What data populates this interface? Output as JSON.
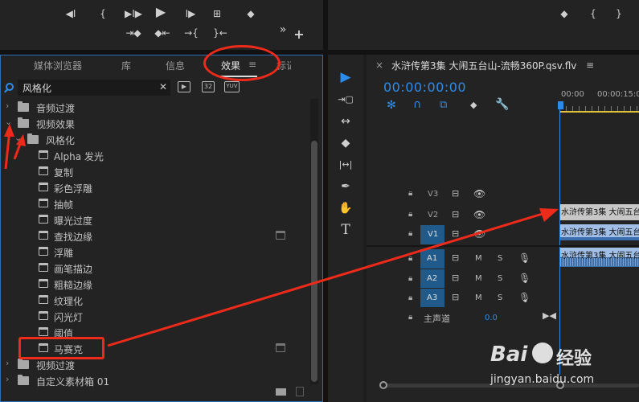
{
  "transport": {
    "source_buttons": [
      "◀I",
      "{",
      "▶I▶",
      "▶",
      "I▶",
      "⊞",
      "◆"
    ],
    "source_row2": [
      "⇥◆",
      "◆⇤",
      "→{",
      "}←"
    ],
    "more": "»",
    "add": "+",
    "program_buttons": [
      "◆",
      "{",
      "}"
    ]
  },
  "effects_panel": {
    "tabs": [
      "媒体浏览器",
      "库",
      "信息",
      "效果",
      "标记"
    ],
    "active_tab": "效果",
    "menu_icon": "≡",
    "search_value": "风格化",
    "clear_icon": "✕",
    "filter_badges": [
      "▶",
      "32",
      "YUV"
    ],
    "tree": [
      {
        "label": "音频过渡",
        "type": "folder",
        "expanded": false
      },
      {
        "label": "视频效果",
        "type": "folder",
        "expanded": true
      },
      {
        "label": "风格化",
        "type": "folder",
        "expanded": true
      },
      {
        "label": "Alpha 发光",
        "type": "effect"
      },
      {
        "label": "复制",
        "type": "effect"
      },
      {
        "label": "彩色浮雕",
        "type": "effect"
      },
      {
        "label": "抽帧",
        "type": "effect"
      },
      {
        "label": "曝光过度",
        "type": "effect"
      },
      {
        "label": "查找边缘",
        "type": "effect",
        "accelerated": true
      },
      {
        "label": "浮雕",
        "type": "effect"
      },
      {
        "label": "画笔描边",
        "type": "effect"
      },
      {
        "label": "粗糙边缘",
        "type": "effect"
      },
      {
        "label": "纹理化",
        "type": "effect"
      },
      {
        "label": "闪光灯",
        "type": "effect"
      },
      {
        "label": "阈值",
        "type": "effect"
      },
      {
        "label": "马赛克",
        "type": "effect",
        "accelerated": true
      },
      {
        "label": "视频过渡",
        "type": "folder",
        "expanded": false
      },
      {
        "label": "自定义素材箱 01",
        "type": "folder",
        "expanded": false
      }
    ]
  },
  "tools": [
    "▶",
    "⇥▢",
    "↔",
    "◆",
    "|↔|",
    "✒",
    "✋",
    "T"
  ],
  "timeline": {
    "close": "×",
    "title": "水浒传第3集 大闹五台山-流畅360P.qsv.flv",
    "menu_icon": "≡",
    "timecode": "00:00:00:00",
    "ruler": [
      "00:00",
      "00:00:15:00"
    ],
    "tracks": [
      {
        "id": "V3",
        "targeted": false,
        "type": "video"
      },
      {
        "id": "V2",
        "targeted": false,
        "type": "video"
      },
      {
        "id": "V1",
        "targeted": true,
        "type": "video"
      },
      {
        "id": "A1",
        "targeted": true,
        "type": "audio"
      },
      {
        "id": "A2",
        "targeted": true,
        "type": "audio"
      },
      {
        "id": "A3",
        "targeted": true,
        "type": "audio"
      }
    ],
    "master_label": "主声道",
    "master_value": "0.0",
    "mute": "M",
    "solo": "S",
    "clip_label": "水浒传第3集 大闹五台山"
  },
  "watermark": {
    "brand": "Bai",
    "brand2": "经验",
    "url": "jingyan.baidu.com"
  },
  "colors": {
    "accent_blue": "#2d8ceb",
    "annotation_red": "#ee2a1a",
    "target_blue": "#1f5a8a",
    "clip_video": "#a0bee6",
    "clip_audio": "#3e6fa8"
  }
}
